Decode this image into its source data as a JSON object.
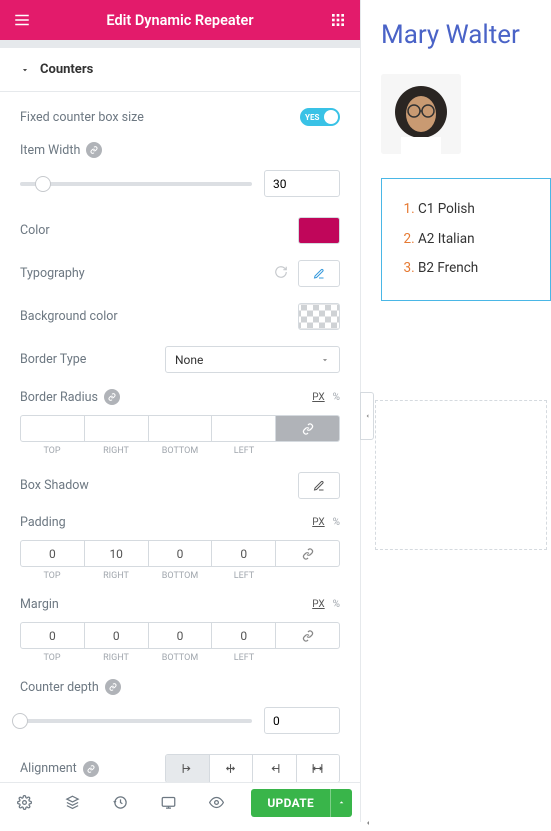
{
  "header": {
    "title": "Edit Dynamic Repeater"
  },
  "section": {
    "counters_label": "Counters"
  },
  "controls": {
    "fixed_counter_label": "Fixed counter box size",
    "fixed_counter_toggle_yes": "YES",
    "item_width_label": "Item Width",
    "item_width_value": "30",
    "color_label": "Color",
    "color_value": "#c0065a",
    "typography_label": "Typography",
    "background_color_label": "Background color",
    "border_type_label": "Border Type",
    "border_type_value": "None",
    "border_radius_label": "Border Radius",
    "box_shadow_label": "Box Shadow",
    "padding_label": "Padding",
    "padding": {
      "top": "0",
      "right": "10",
      "bottom": "0",
      "left": "0"
    },
    "margin_label": "Margin",
    "margin": {
      "top": "0",
      "right": "0",
      "bottom": "0",
      "left": "0"
    },
    "counter_depth_label": "Counter depth",
    "counter_depth_value": "0",
    "alignment_label": "Alignment",
    "dim_labels": {
      "top": "TOP",
      "right": "RIGHT",
      "bottom": "BOTTOM",
      "left": "LEFT"
    },
    "units": {
      "px": "PX",
      "pct": "%"
    }
  },
  "footer": {
    "update_label": "UPDATE"
  },
  "preview": {
    "name": "Mary Walter",
    "skills": [
      {
        "label": "C1 Polish"
      },
      {
        "label": "A2 Italian"
      },
      {
        "label": "B2 French"
      }
    ]
  }
}
